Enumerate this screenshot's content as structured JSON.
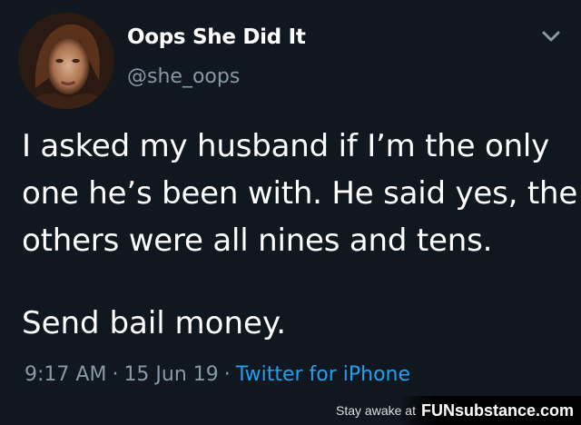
{
  "tweet": {
    "display_name": "Oops She Did It",
    "handle": "@she_oops",
    "lines": [
      "I asked my husband if I’m the only",
      "one he’s been with. He said yes, the",
      "others were all nines and tens."
    ],
    "closing": "Send bail money.",
    "time": "9:17 AM",
    "date": "15 Jun 19",
    "source": "Twitter for iPhone"
  },
  "watermark": {
    "prefix": "Stay awake at",
    "brand": "FUNsubstance.com"
  },
  "icons": {
    "menu": "chevron-down-icon",
    "profile": "avatar"
  },
  "colors": {
    "background": "#10171e",
    "text": "#ffffff",
    "muted": "#8899a6",
    "link": "#1da1f2"
  }
}
